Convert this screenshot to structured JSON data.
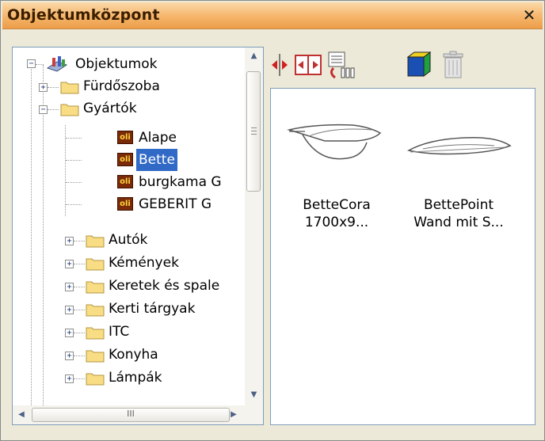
{
  "window": {
    "title": "Objektumközpont",
    "close_glyph": "✕"
  },
  "tree": {
    "root_label": "Objektumok",
    "items": [
      {
        "label": "Fürdőszoba",
        "type": "folder",
        "level": 1,
        "expanded": false
      },
      {
        "label": "Gyártók",
        "type": "folder",
        "level": 1,
        "expanded": true
      },
      {
        "label": "Alape",
        "type": "object",
        "level": 2
      },
      {
        "label": "Bette",
        "type": "object",
        "level": 2,
        "selected": true
      },
      {
        "label": "burgkama G",
        "type": "object",
        "level": 2
      },
      {
        "label": "GEBERIT G",
        "type": "object",
        "level": 2
      },
      {
        "label": "Autók",
        "type": "folder",
        "level": 1,
        "expanded": false
      },
      {
        "label": "Kémények",
        "type": "folder",
        "level": 1,
        "expanded": false
      },
      {
        "label": "Keretek és spale",
        "type": "folder",
        "level": 1,
        "expanded": false
      },
      {
        "label": "Kerti tárgyak",
        "type": "folder",
        "level": 1,
        "expanded": false
      },
      {
        "label": "ITC",
        "type": "folder",
        "level": 1,
        "expanded": false
      },
      {
        "label": "Konyha",
        "type": "folder",
        "level": 1,
        "expanded": false
      },
      {
        "label": "Lámpák",
        "type": "folder",
        "level": 1,
        "expanded": false
      }
    ],
    "object_badge": "oli",
    "hscroll_grip": "III"
  },
  "toolbar": {
    "tools": [
      {
        "name": "move-left-right-icon"
      },
      {
        "name": "fit-width-icon"
      },
      {
        "name": "list-view-icon"
      },
      {
        "name": "3d-view-icon"
      },
      {
        "name": "trash-icon"
      }
    ]
  },
  "content": {
    "items": [
      {
        "name_line1": "BetteCora",
        "name_line2": "1700x9..."
      },
      {
        "name_line1": "BettePoint",
        "name_line2": "Wand mit S..."
      }
    ]
  },
  "colors": {
    "title_gradient_top": "#fbd9a9",
    "title_gradient_bottom": "#ec9d49",
    "selection": "#3169c6",
    "folder_fill": "#f8dd84"
  }
}
